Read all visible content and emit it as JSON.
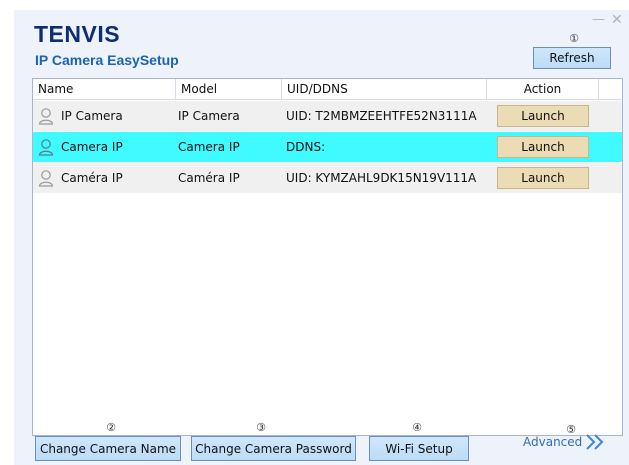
{
  "app": {
    "logo_text": "TENVIS",
    "title": "IP Camera EasySetup",
    "minimize_glyph": "—",
    "close_glyph": "✕"
  },
  "markers": {
    "refresh": "①",
    "change_name": "②",
    "change_password": "③",
    "wifi_setup": "④",
    "advanced": "⑤"
  },
  "toolbar": {
    "refresh_label": "Refresh"
  },
  "table": {
    "columns": [
      "Name",
      "Model",
      "UID/DDNS",
      "Action"
    ],
    "rows": [
      {
        "name": "IP Camera",
        "model": "IP Camera",
        "uid": "UID: T2MBMZEEHTFE52N3111A",
        "action": "Launch",
        "selected": false
      },
      {
        "name": "Camera IP",
        "model": "Camera IP",
        "uid": "DDNS:",
        "action": "Launch",
        "selected": true
      },
      {
        "name": "Caméra IP",
        "model": "Caméra IP",
        "uid": "UID: KYMZAHL9DK15N19V111A",
        "action": "Launch",
        "selected": false
      }
    ]
  },
  "footer": {
    "change_name_label": "Change Camera Name",
    "change_password_label": "Change Camera Password",
    "wifi_setup_label": "Wi-Fi Setup",
    "advanced_label": "Advanced"
  },
  "colors": {
    "selected_row": "#3ffaff",
    "launch_button": "#ecdcb6",
    "logo": "#0d2e73",
    "title": "#1a64b2",
    "advanced_link": "#2f6fb8"
  },
  "icons": {
    "row_icon": "user-icon",
    "advanced_icon": "double-chevron-right-icon"
  }
}
